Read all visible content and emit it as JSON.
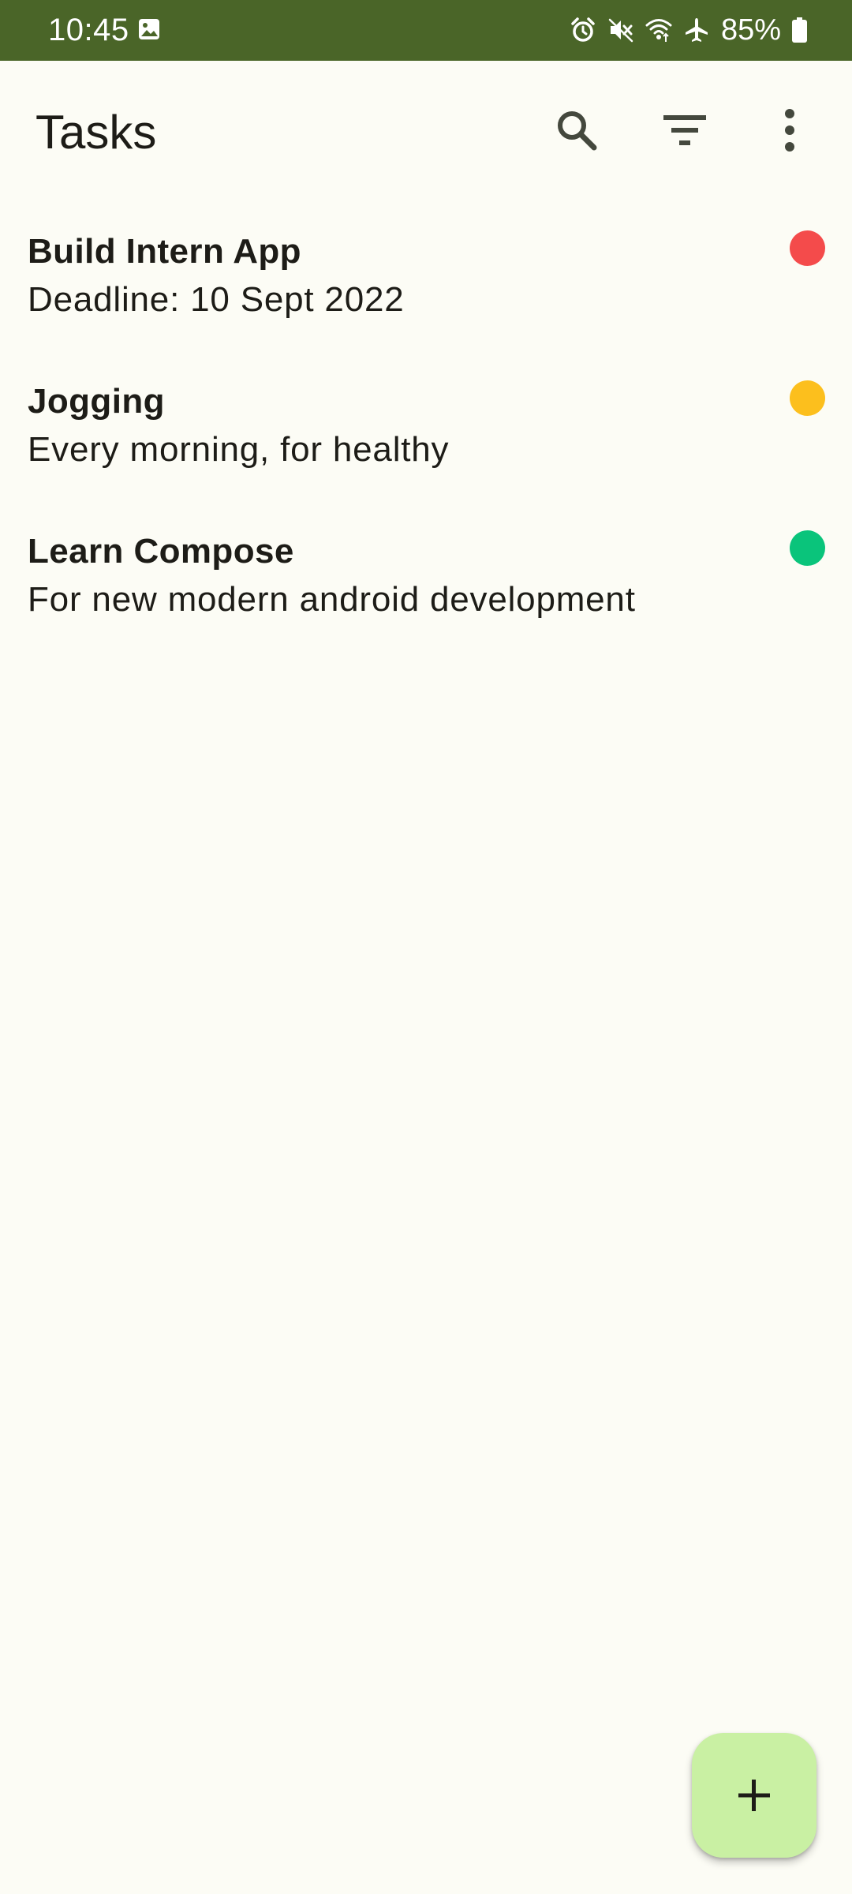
{
  "status_bar": {
    "time": "10:45",
    "battery_text": "85%",
    "icons": [
      "gallery-icon",
      "alarm-icon",
      "mute-icon",
      "wifi-icon",
      "airplane-icon",
      "battery-icon"
    ],
    "background": "#4a6528"
  },
  "app_bar": {
    "title": "Tasks",
    "actions": [
      "search-icon",
      "filter-icon",
      "more-vert-icon"
    ]
  },
  "tasks": [
    {
      "title": "Build Intern App",
      "description": "Deadline: 10 Sept 2022",
      "priority_color": "#f44b4b"
    },
    {
      "title": "Jogging",
      "description": "Every morning, for healthy",
      "priority_color": "#fcbf1d"
    },
    {
      "title": "Learn Compose",
      "description": "For new modern android development",
      "priority_color": "#0ac47b"
    }
  ],
  "fab": {
    "icon": "add-icon",
    "background": "#c9f0a3"
  },
  "colors": {
    "background": "#fcfcf5",
    "text": "#1d1c17"
  }
}
